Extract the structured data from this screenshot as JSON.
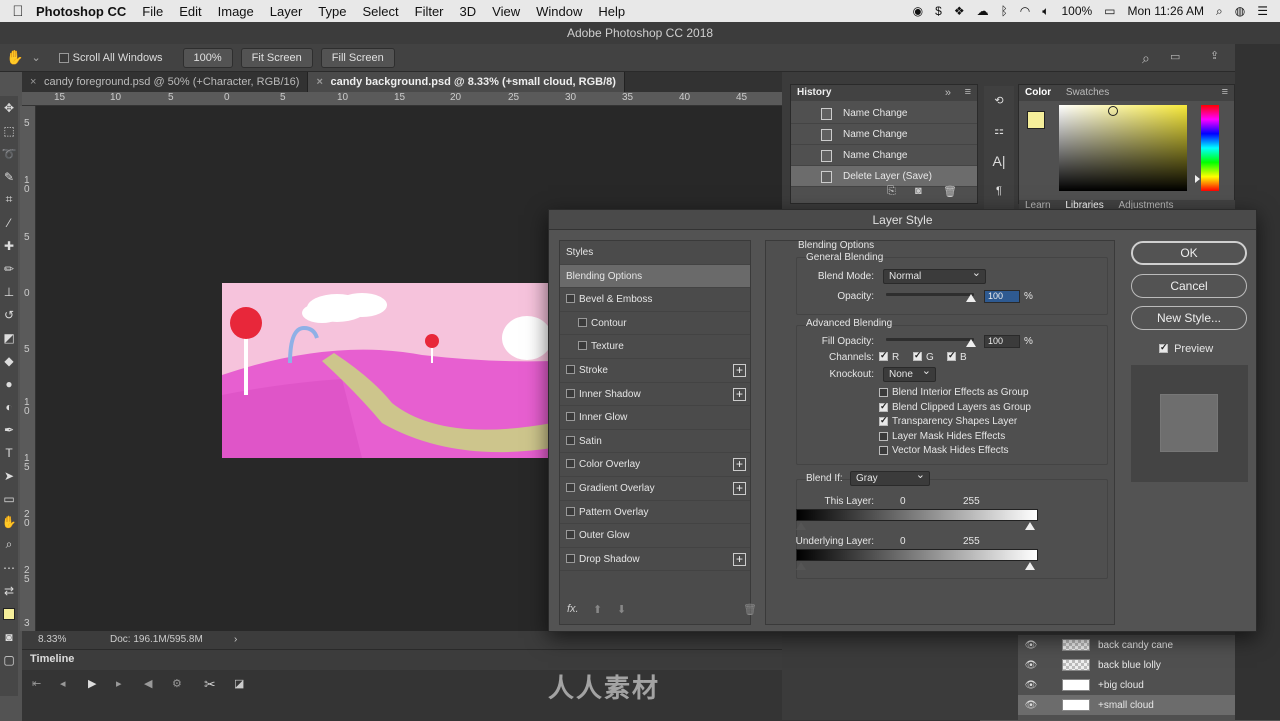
{
  "menubar": {
    "app_name": "Photoshop CC",
    "items": [
      "File",
      "Edit",
      "Image",
      "Layer",
      "Type",
      "Select",
      "Filter",
      "3D",
      "View",
      "Window",
      "Help"
    ],
    "battery": "100%",
    "clock": "Mon 11:26 AM"
  },
  "titlebar": {
    "title": "Adobe Photoshop CC 2018"
  },
  "options": {
    "scroll_all": "Scroll All Windows",
    "zoom_btn": "100%",
    "fit_btn": "Fit Screen",
    "fill_btn": "Fill Screen"
  },
  "tabs": [
    {
      "label": "candy foreground.psd @ 50% (+Character, RGB/16)"
    },
    {
      "label": "candy background.psd @ 8.33% (+small cloud, RGB/8)"
    }
  ],
  "rulers": {
    "h": [
      "15",
      "10",
      "5",
      "0",
      "5",
      "10",
      "15",
      "20",
      "25",
      "30",
      "35",
      "40",
      "45"
    ],
    "v": [
      "5",
      "1 0",
      "5",
      "0",
      "5",
      "1 0",
      "1 5",
      "2 0",
      "2 5",
      "3"
    ]
  },
  "status": {
    "zoom": "8.33%",
    "doc": "Doc: 196.1M/595.8M"
  },
  "timeline": {
    "title": "Timeline"
  },
  "history": {
    "title": "History",
    "items": [
      {
        "label": "Name Change"
      },
      {
        "label": "Name Change"
      },
      {
        "label": "Name Change"
      },
      {
        "label": "Delete Layer (Save)"
      }
    ]
  },
  "color_panel": {
    "tab_color": "Color",
    "tab_swatches": "Swatches",
    "tab_learn": "Learn",
    "tab_libraries": "Libraries",
    "tab_adjustments": "Adjustments",
    "fg_color": "#f5ee9a",
    "hue_color": "#f7e93a"
  },
  "layers": [
    {
      "name": "back candy cane"
    },
    {
      "name": "back blue lolly"
    },
    {
      "name": "+big cloud"
    },
    {
      "name": "+small cloud"
    }
  ],
  "dialog": {
    "title": "Layer Style",
    "styles_header": "Styles",
    "styles": [
      {
        "label": "Blending Options",
        "selected": true,
        "checkbox": false,
        "plus": false,
        "indent": false
      },
      {
        "label": "Bevel & Emboss",
        "checkbox": true,
        "plus": false,
        "indent": false
      },
      {
        "label": "Contour",
        "checkbox": true,
        "plus": false,
        "indent": true
      },
      {
        "label": "Texture",
        "checkbox": true,
        "plus": false,
        "indent": true
      },
      {
        "label": "Stroke",
        "checkbox": true,
        "plus": true,
        "indent": false
      },
      {
        "label": "Inner Shadow",
        "checkbox": true,
        "plus": true,
        "indent": false
      },
      {
        "label": "Inner Glow",
        "checkbox": true,
        "plus": false,
        "indent": false
      },
      {
        "label": "Satin",
        "checkbox": true,
        "plus": false,
        "indent": false
      },
      {
        "label": "Color Overlay",
        "checkbox": true,
        "plus": true,
        "indent": false
      },
      {
        "label": "Gradient Overlay",
        "checkbox": true,
        "plus": true,
        "indent": false
      },
      {
        "label": "Pattern Overlay",
        "checkbox": true,
        "plus": false,
        "indent": false
      },
      {
        "label": "Outer Glow",
        "checkbox": true,
        "plus": false,
        "indent": false
      },
      {
        "label": "Drop Shadow",
        "checkbox": true,
        "plus": true,
        "indent": false
      }
    ],
    "blending": {
      "section": "Blending Options",
      "general": "General Blending",
      "blend_mode_label": "Blend Mode:",
      "blend_mode_value": "Normal",
      "opacity_label": "Opacity:",
      "opacity_value": "100",
      "percent": "%",
      "advanced": "Advanced Blending",
      "fill_label": "Fill Opacity:",
      "fill_value": "100",
      "channels_label": "Channels:",
      "ch_r": "R",
      "ch_g": "G",
      "ch_b": "B",
      "knockout_label": "Knockout:",
      "knockout_value": "None",
      "opt1": "Blend Interior Effects as Group",
      "opt2": "Blend Clipped Layers as Group",
      "opt3": "Transparency Shapes Layer",
      "opt4": "Layer Mask Hides Effects",
      "opt5": "Vector Mask Hides Effects",
      "blend_if_label": "Blend If:",
      "blend_if_value": "Gray",
      "this_layer": "This Layer:",
      "underlying": "Underlying Layer:",
      "low": "0",
      "high": "255"
    },
    "buttons": {
      "ok": "OK",
      "cancel": "Cancel",
      "new_style": "New Style...",
      "preview": "Preview"
    }
  },
  "watermark": "人人素材"
}
